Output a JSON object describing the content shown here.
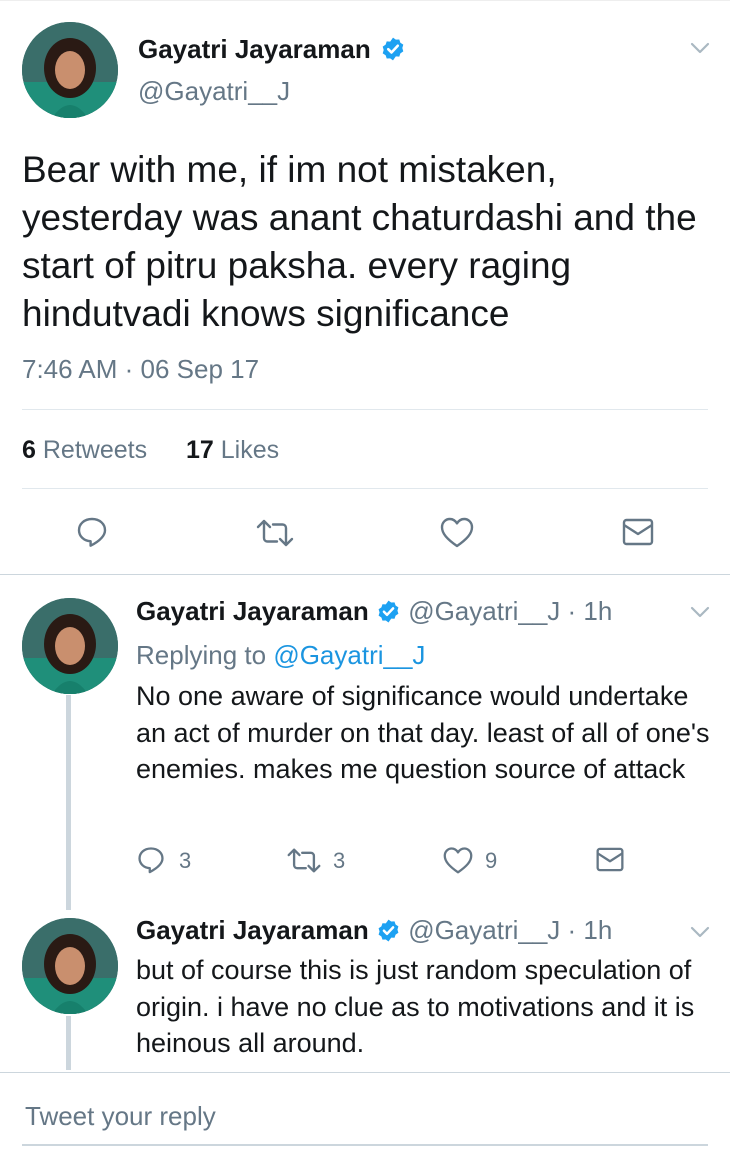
{
  "main_tweet": {
    "author_name": "Gayatri Jayaraman",
    "handle": "@Gayatri__J",
    "text": "Bear with me, if im not mistaken, yesterday was anant chaturdashi and the start of pitru paksha. every raging hindutvadi knows significance",
    "timestamp": "7:46 AM · 06 Sep 17",
    "retweets_count": "6",
    "retweets_label": "Retweets",
    "likes_count": "17",
    "likes_label": "Likes"
  },
  "replies": [
    {
      "author_name": "Gayatri Jayaraman",
      "handle_time": "@Gayatri__J · 1h",
      "replying_prefix": "Replying to",
      "replying_handle": "@Gayatri__J",
      "text": "No one aware of significance would undertake an act of murder on that day. least of all of one's enemies. makes me question source of attack",
      "reply_count": "3",
      "retweet_count": "3",
      "like_count": "9"
    },
    {
      "author_name": "Gayatri Jayaraman",
      "handle_time": "@Gayatri__J · 1h",
      "text": "but of course this is just random speculation of origin. i have no clue as to motivations and it is heinous all around."
    }
  ],
  "compose": {
    "placeholder": "Tweet your reply"
  },
  "colors": {
    "verified": "#1da1f2",
    "secondary_text": "#657786",
    "link": "#1b95e0",
    "divider": "#e1e8ed"
  },
  "icons": [
    "verified-badge-icon",
    "chevron-down-icon",
    "reply-icon",
    "retweet-icon",
    "like-icon",
    "direct-message-icon"
  ]
}
